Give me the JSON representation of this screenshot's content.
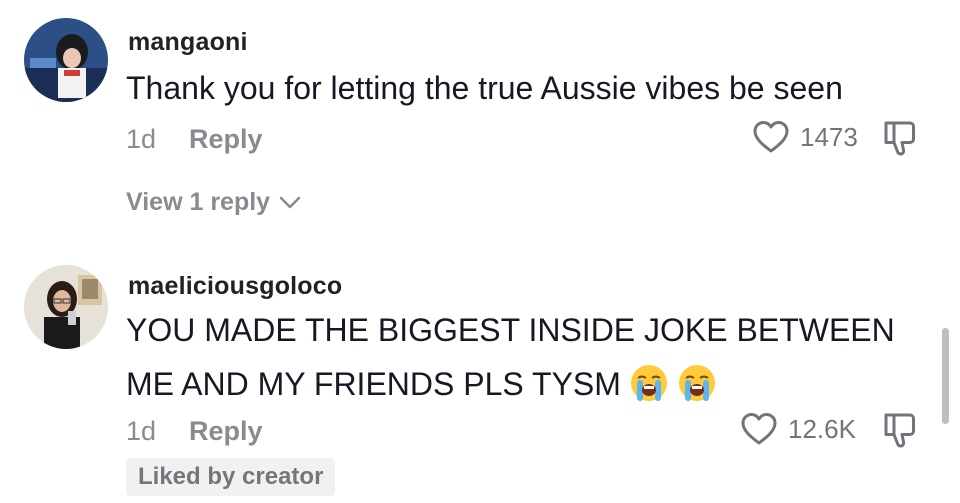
{
  "comments": [
    {
      "username": "mangaoni",
      "text": "Thank you for letting the true Aussie vibes be seen",
      "time": "1d",
      "reply_label": "Reply",
      "likes": "1473",
      "view_replies": "View 1 reply"
    },
    {
      "username": "maeliciousgoloco",
      "text_line1": "YOU MADE THE BIGGEST INSIDE JOKE BETWEEN",
      "text_line2": "ME AND MY FRIENDS PLS TYSM",
      "emojis": [
        "loudly-crying-face",
        "loudly-crying-face"
      ],
      "time": "1d",
      "reply_label": "Reply",
      "likes": "12.6K",
      "liked_by_creator": "Liked by creator"
    }
  ],
  "icons": {
    "like": "heart-outline-icon",
    "dislike": "thumbs-down-outline-icon",
    "expand": "chevron-down-icon"
  },
  "colors": {
    "text": "#161823",
    "muted": "#8a8b91",
    "badge_bg": "#f1f1f2"
  }
}
